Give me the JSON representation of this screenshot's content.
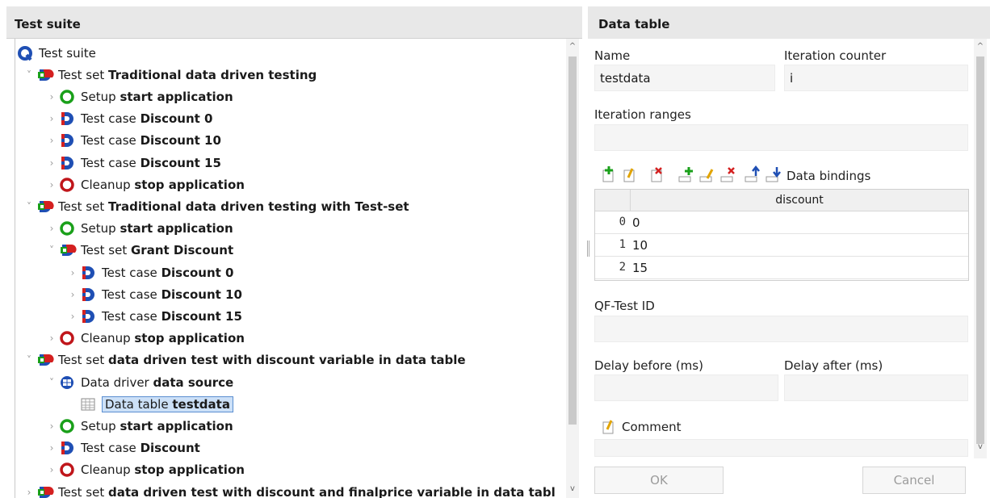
{
  "left": {
    "header_title": "Test suite",
    "tree": [
      {
        "icon": "suite",
        "prefix": "Test suite",
        "name": "",
        "chev": "",
        "depth": 0
      },
      {
        "icon": "testset",
        "prefix": "Test set ",
        "name": "Traditional data driven testing",
        "chev": "v",
        "depth": 1
      },
      {
        "icon": "setup",
        "prefix": "Setup ",
        "name": "start application",
        "chev": ">",
        "depth": 2
      },
      {
        "icon": "testcase",
        "prefix": "Test case ",
        "name": "Discount 0",
        "chev": ">",
        "depth": 2
      },
      {
        "icon": "testcase",
        "prefix": "Test case ",
        "name": "Discount 10",
        "chev": ">",
        "depth": 2
      },
      {
        "icon": "testcase",
        "prefix": "Test case ",
        "name": "Discount 15",
        "chev": ">",
        "depth": 2
      },
      {
        "icon": "cleanup",
        "prefix": "Cleanup ",
        "name": "stop application",
        "chev": ">",
        "depth": 2
      },
      {
        "icon": "testset",
        "prefix": "Test set ",
        "name": "Traditional data driven testing with Test-set",
        "chev": "v",
        "depth": 1
      },
      {
        "icon": "setup",
        "prefix": "Setup ",
        "name": "start application",
        "chev": ">",
        "depth": 2
      },
      {
        "icon": "testset",
        "prefix": "Test set ",
        "name": "Grant Discount",
        "chev": "v",
        "depth": 2
      },
      {
        "icon": "testcase",
        "prefix": "Test case ",
        "name": "Discount 0",
        "chev": ">",
        "depth": 3
      },
      {
        "icon": "testcase",
        "prefix": "Test case ",
        "name": "Discount 10",
        "chev": ">",
        "depth": 3
      },
      {
        "icon": "testcase",
        "prefix": "Test case ",
        "name": "Discount 15",
        "chev": ">",
        "depth": 3
      },
      {
        "icon": "cleanup",
        "prefix": "Cleanup ",
        "name": "stop application",
        "chev": ">",
        "depth": 2
      },
      {
        "icon": "testset",
        "prefix": "Test set ",
        "name": "data driven test with discount variable in data table",
        "chev": "v",
        "depth": 1
      },
      {
        "icon": "datadriver",
        "prefix": "Data driver ",
        "name": "data source",
        "chev": "v",
        "depth": 2
      },
      {
        "icon": "datatable",
        "prefix": "Data table ",
        "name": "testdata",
        "chev": "",
        "depth": 3,
        "selected": true
      },
      {
        "icon": "setup",
        "prefix": "Setup ",
        "name": "start application",
        "chev": ">",
        "depth": 2
      },
      {
        "icon": "testcase",
        "prefix": "Test case ",
        "name": "Discount",
        "chev": ">",
        "depth": 2
      },
      {
        "icon": "cleanup",
        "prefix": "Cleanup ",
        "name": "stop application",
        "chev": ">",
        "depth": 2
      },
      {
        "icon": "testset",
        "prefix": "Test set ",
        "name": "data driven test with discount and finalprice variable in data tabl",
        "chev": ">",
        "depth": 1
      }
    ]
  },
  "right": {
    "header_title": "Data table",
    "name_label": "Name",
    "name_value": "testdata",
    "iter_counter_label": "Iteration counter",
    "iter_counter_value": "i",
    "iter_ranges_label": "Iteration ranges",
    "iter_ranges_value": "",
    "bindings_label": "Data bindings",
    "grid": {
      "column": "discount",
      "rows": [
        {
          "idx": "0",
          "value": "0"
        },
        {
          "idx": "1",
          "value": "10"
        },
        {
          "idx": "2",
          "value": "15"
        }
      ]
    },
    "qfid_label": "QF-Test ID",
    "qfid_value": "",
    "delay_before_label": "Delay before (ms)",
    "delay_before_value": "",
    "delay_after_label": "Delay after (ms)",
    "delay_after_value": "",
    "comment_label": "Comment",
    "comment_value": "",
    "ok_label": "OK",
    "cancel_label": "Cancel"
  },
  "colors": {
    "setup": "#1aa01a",
    "cleanup": "#c0161b",
    "testcase_blue": "#1f4fb4",
    "testcase_red": "#d42020",
    "selection": "#cce0f7"
  }
}
